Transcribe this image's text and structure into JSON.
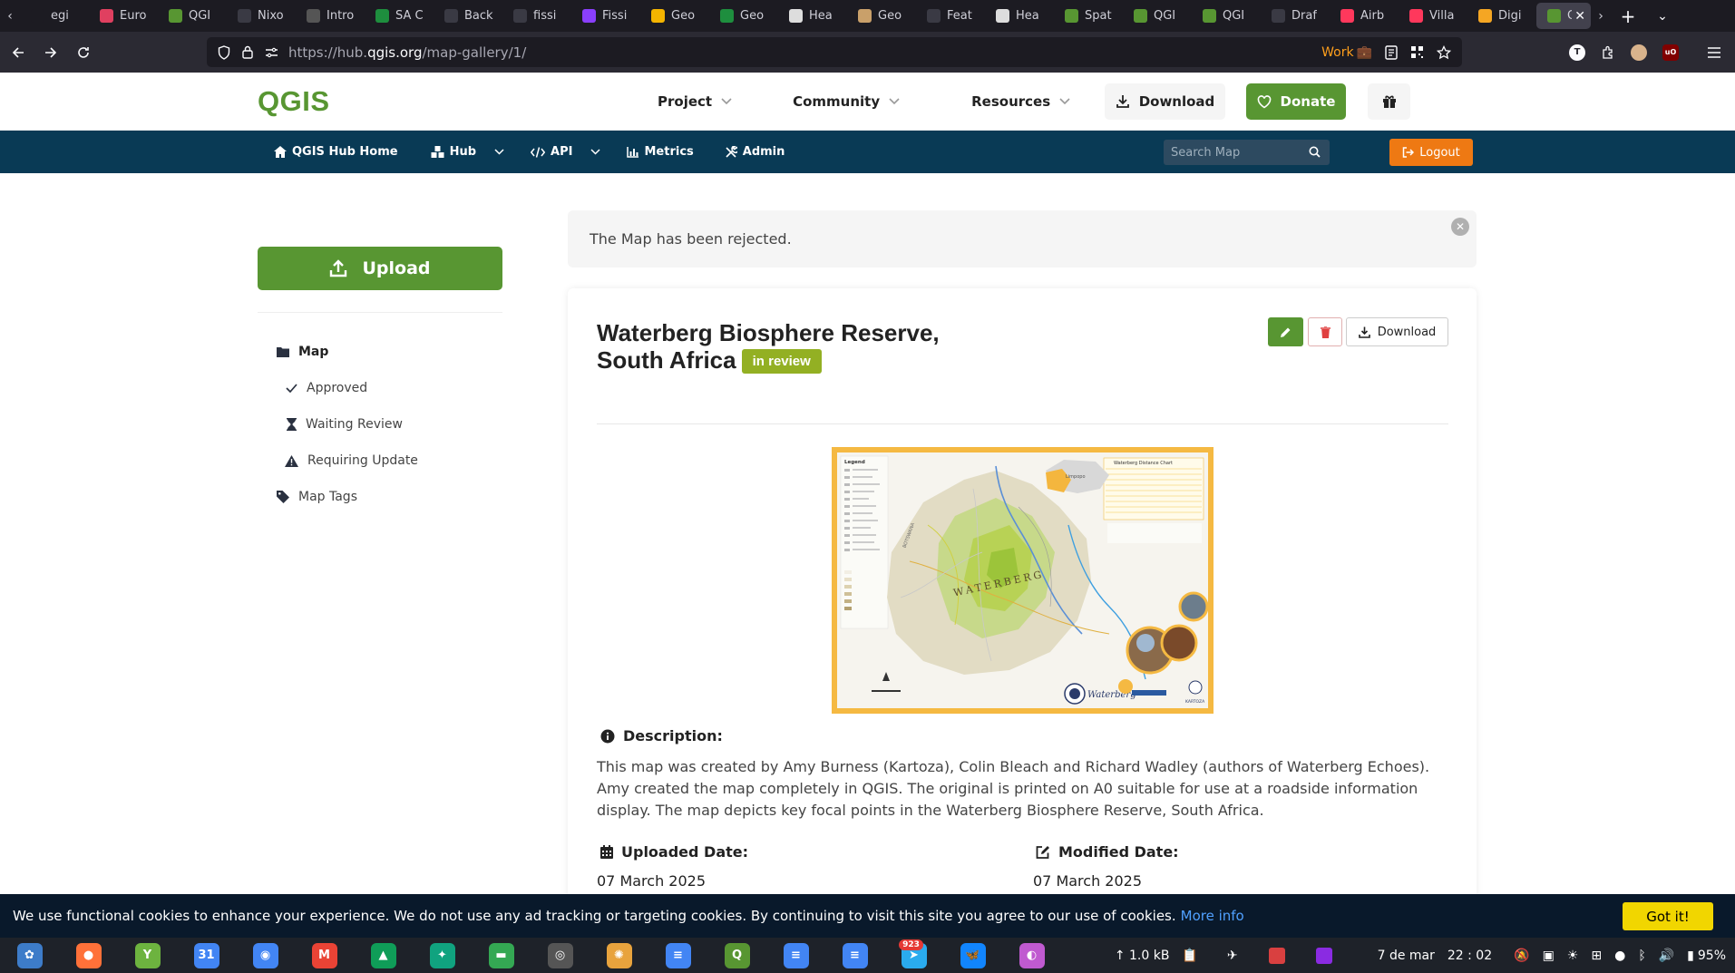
{
  "browser": {
    "tabs": [
      {
        "label": "egi",
        "icon": "text-icon",
        "color": "#1c1b22"
      },
      {
        "label": "Euro",
        "icon": "dots-icon",
        "color": "#e04060"
      },
      {
        "label": "QGI",
        "icon": "qgis-icon",
        "color": "#589632"
      },
      {
        "label": "Nixo",
        "icon": "github-icon",
        "color": "#3a3a44"
      },
      {
        "label": "Intro",
        "icon": "book-icon",
        "color": "#555"
      },
      {
        "label": "SA C",
        "icon": "sheets-icon",
        "color": "#1e8e3e"
      },
      {
        "label": "Back",
        "icon": "github-icon",
        "color": "#3a3a44"
      },
      {
        "label": "fissi",
        "icon": "github-icon",
        "color": "#3a3a44"
      },
      {
        "label": "Fissi",
        "icon": "circle-icon",
        "color": "#8a3ffc"
      },
      {
        "label": "Geo",
        "icon": "drive-icon",
        "color": "#f4b400"
      },
      {
        "label": "Geo",
        "icon": "sheets-icon",
        "color": "#1e8e3e"
      },
      {
        "label": "Hea",
        "icon": "pin-icon",
        "color": "#ddd"
      },
      {
        "label": "Geo",
        "icon": "person-icon",
        "color": "#c9a06a"
      },
      {
        "label": "Feat",
        "icon": "github-icon",
        "color": "#3a3a44"
      },
      {
        "label": "Hea",
        "icon": "mascot-icon",
        "color": "#ddd"
      },
      {
        "label": "Spat",
        "icon": "qgis-icon",
        "color": "#589632"
      },
      {
        "label": "QGI",
        "icon": "qgis-icon",
        "color": "#589632"
      },
      {
        "label": "QGI",
        "icon": "qgis-icon",
        "color": "#589632"
      },
      {
        "label": "Draf",
        "icon": "github-icon",
        "color": "#3a3a44"
      },
      {
        "label": "Airb",
        "icon": "airbnb-icon",
        "color": "#ff385c"
      },
      {
        "label": "Villa",
        "icon": "airbnb-icon",
        "color": "#ff385c"
      },
      {
        "label": "Digi",
        "icon": "pencil-icon",
        "color": "#f5a623"
      },
      {
        "label": "QG",
        "icon": "qgis-icon",
        "color": "#589632",
        "active": true
      }
    ],
    "url_prefix": "https://hub.",
    "url_domain": "qgis.org",
    "url_path": "/map-gallery/1/",
    "container_label": "Work"
  },
  "site": {
    "logo": "QGIS",
    "nav": [
      "Project",
      "Community",
      "Resources"
    ],
    "download_label": "Download",
    "donate_label": "Donate",
    "brand_color": "#589632"
  },
  "hub": {
    "items": [
      {
        "label": "QGIS Hub Home",
        "icon": "home-icon",
        "dropdown": false
      },
      {
        "label": "Hub",
        "icon": "cubes-icon",
        "dropdown": true
      },
      {
        "label": "API",
        "icon": "code-icon",
        "dropdown": true
      },
      {
        "label": "Metrics",
        "icon": "chart-icon",
        "dropdown": false
      },
      {
        "label": "Admin",
        "icon": "tools-icon",
        "dropdown": false
      }
    ],
    "search_placeholder": "Search Map",
    "logout_label": "Logout"
  },
  "sidebar": {
    "upload_label": "Upload",
    "section": "Map",
    "items": [
      {
        "label": "Approved",
        "icon": "check-icon"
      },
      {
        "label": "Waiting Review",
        "icon": "hourglass-icon"
      },
      {
        "label": "Requiring Update",
        "icon": "warning-icon"
      }
    ],
    "tags_label": "Map Tags"
  },
  "alert": {
    "message": "The Map has been rejected."
  },
  "map": {
    "title_line1": "Waterberg Biosphere Reserve,",
    "title_line2": "South Africa",
    "status": "in review",
    "download_label": "Download",
    "description_label": "Description:",
    "description": "This map was created by Amy Burness (Kartoza), Colin Bleach and Richard Wadley (authors of Waterberg Echoes). Amy created the map completely in QGIS. The original is printed on A0 suitable for use at a roadside information display. The map depicts key focal points in the Waterberg Biosphere Reserve, South Africa.",
    "uploaded_label": "Uploaded Date:",
    "uploaded_date": "07 March 2025",
    "modified_label": "Modified Date:",
    "modified_date": "07 March 2025",
    "image": {
      "legend_title": "Legend",
      "chart_title": "Waterberg Distance Chart",
      "region_label": "WATERBERG",
      "limpopo_label": "Limpopo",
      "country_label": "BOTSWANA",
      "footer_brand": "Waterberg",
      "logo_text": "KARTOZA"
    }
  },
  "cookie": {
    "text": "We use functional cookies to enhance your experience. We do not use any ad tracking or targeting cookies. By continuing to visit this site you agree to our use of cookies.",
    "more_info": "More info",
    "button": "Got it!"
  },
  "taskbar": {
    "apps": [
      {
        "name": "launcher-icon",
        "color": "#3d7cc9",
        "glyph": "✿"
      },
      {
        "name": "firefox-icon",
        "color": "#ff7139",
        "glyph": "●"
      },
      {
        "name": "keepass-icon",
        "color": "#6db33f",
        "glyph": "Y"
      },
      {
        "name": "calendar-icon",
        "color": "#4285f4",
        "glyph": "31"
      },
      {
        "name": "chromium-icon",
        "color": "#4285f4",
        "glyph": "◉"
      },
      {
        "name": "gmail-icon",
        "color": "#ea4335",
        "glyph": "M"
      },
      {
        "name": "gdrive-icon",
        "color": "#0f9d58",
        "glyph": "▲"
      },
      {
        "name": "chatgpt-icon",
        "color": "#10a37f",
        "glyph": "✦"
      },
      {
        "name": "chat-icon",
        "color": "#34a853",
        "glyph": "▬"
      },
      {
        "name": "obs-icon",
        "color": "#555",
        "glyph": "◎"
      },
      {
        "name": "settings-icon",
        "color": "#e8a33d",
        "glyph": "✺"
      },
      {
        "name": "docs-icon",
        "color": "#4285f4",
        "glyph": "≡"
      },
      {
        "name": "qgis-app-icon",
        "color": "#589632",
        "glyph": "Q"
      },
      {
        "name": "docs-icon-2",
        "color": "#4285f4",
        "glyph": "≡"
      },
      {
        "name": "docs-icon-3",
        "color": "#4285f4",
        "glyph": "≡"
      },
      {
        "name": "telegram-icon",
        "color": "#2aabee",
        "glyph": "➤",
        "badge": "923"
      },
      {
        "name": "bluesky-icon",
        "color": "#1185fe",
        "glyph": "🦋"
      },
      {
        "name": "color-picker-icon",
        "color": "#c05ad0",
        "glyph": "◐"
      }
    ],
    "net_speed": "↑ 1.0 kB",
    "date": "7 de mar",
    "time": "22 : 02",
    "battery": "95%"
  }
}
